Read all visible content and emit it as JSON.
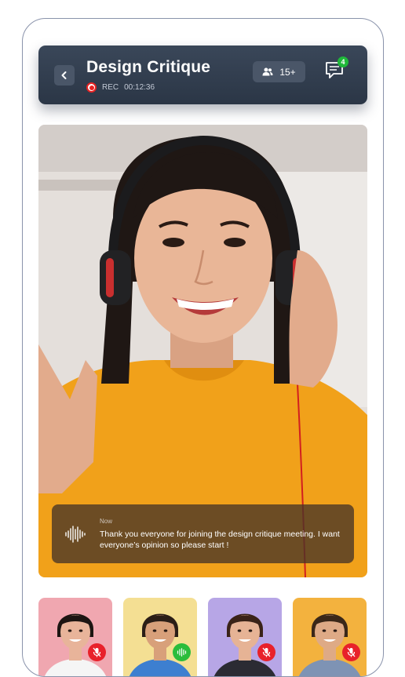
{
  "header": {
    "title": "Design Critique",
    "rec_label": "REC",
    "timer": "00:12:36",
    "participants_count": "15+",
    "chat_badge_count": "4",
    "icons": [
      "chevron-left-icon",
      "record-icon",
      "people-icon",
      "chat-icon"
    ]
  },
  "caption": {
    "time": "Now",
    "text": "Thank you everyone for joining the design critique meeting. I want everyone’s opinion so please start !"
  },
  "participants": [
    {
      "bg": "#f0a7b0",
      "shirt": "#f5f5f5",
      "hair": "#1d1512",
      "skin": "#e8b49a",
      "mic": "muted"
    },
    {
      "bg": "#f4df93",
      "shirt": "#3d7fd0",
      "hair": "#2b1e17",
      "skin": "#d8a07a",
      "mic": "active"
    },
    {
      "bg": "#b7a6e6",
      "shirt": "#2b2b33",
      "hair": "#3a2318",
      "skin": "#e6b395",
      "mic": "muted"
    },
    {
      "bg": "#f3b23e",
      "shirt": "#7e93b4",
      "hair": "#3b2819",
      "skin": "#deaa86",
      "mic": "muted"
    }
  ],
  "colors": {
    "header_bg": "#2f3b4c",
    "rec_red": "#e82323",
    "badge_green": "#1fb83a",
    "mic_muted": "#e8212a",
    "mic_active": "#2bbd3c"
  }
}
